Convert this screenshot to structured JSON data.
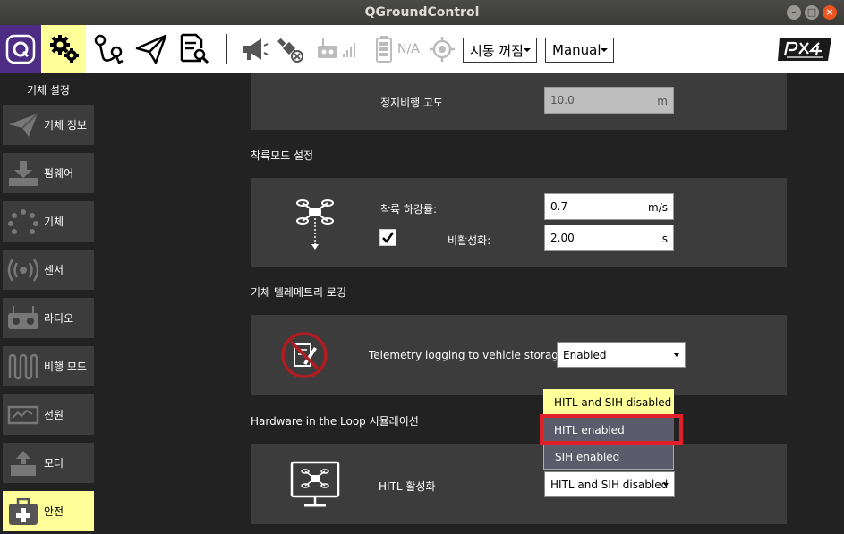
{
  "window": {
    "title": "QGroundControl"
  },
  "toolbar": {
    "arm_state": "시동 꺼짐",
    "flight_mode": "Manual",
    "battery_status": "N/A",
    "brand_logo": "PX4 autopilot",
    "icons": [
      "qgc-logo-icon",
      "settings-gear-icon",
      "plan-icon",
      "fly-icon",
      "analyze-icon",
      "megaphone-icon",
      "gps-off-icon",
      "rc-signal-icon",
      "battery-icon",
      "gps-target-icon"
    ]
  },
  "sidebar": {
    "title": "기체 설정",
    "items": [
      {
        "label": "기체 정보",
        "icon": "airframe-plane-icon"
      },
      {
        "label": "펌웨어",
        "icon": "firmware-download-icon"
      },
      {
        "label": "기체",
        "icon": "airframe-dots-icon"
      },
      {
        "label": "센서",
        "icon": "sensors-icon"
      },
      {
        "label": "라디오",
        "icon": "radio-icon"
      },
      {
        "label": "비행 모드",
        "icon": "flight-modes-icon"
      },
      {
        "label": "전원",
        "icon": "power-icon"
      },
      {
        "label": "모터",
        "icon": "motors-icon"
      },
      {
        "label": "안전",
        "icon": "safety-icon"
      }
    ],
    "active_index": 8
  },
  "rtl": {
    "hover_alt_label": "정지비행 고도",
    "hover_alt_value": "10.0",
    "hover_alt_unit": "m"
  },
  "land_mode": {
    "title": "착륙모드 설정",
    "descent_label": "착륙 하강률:",
    "descent_value": "0.7",
    "descent_unit": "m/s",
    "disarm_label": "비활성화:",
    "disarm_checked": true,
    "disarm_value": "2.00",
    "disarm_unit": "s"
  },
  "telemetry": {
    "title": "기체 텔레메트리 로깅",
    "label": "Telemetry logging to vehicle storage:",
    "value": "Enabled"
  },
  "hitl": {
    "title": "Hardware in the Loop 시뮬레이션",
    "label": "HITL 활성화",
    "value": "HITL and SIH disabled",
    "options": [
      "HITL and SIH disabled",
      "HITL enabled",
      "SIH enabled"
    ],
    "highlighted_option": "HITL enabled"
  },
  "colors": {
    "active": "#ffff99",
    "panel": "#3c3c3c",
    "highlight": "#e0202a",
    "logo_bg": "#4d2d84"
  }
}
